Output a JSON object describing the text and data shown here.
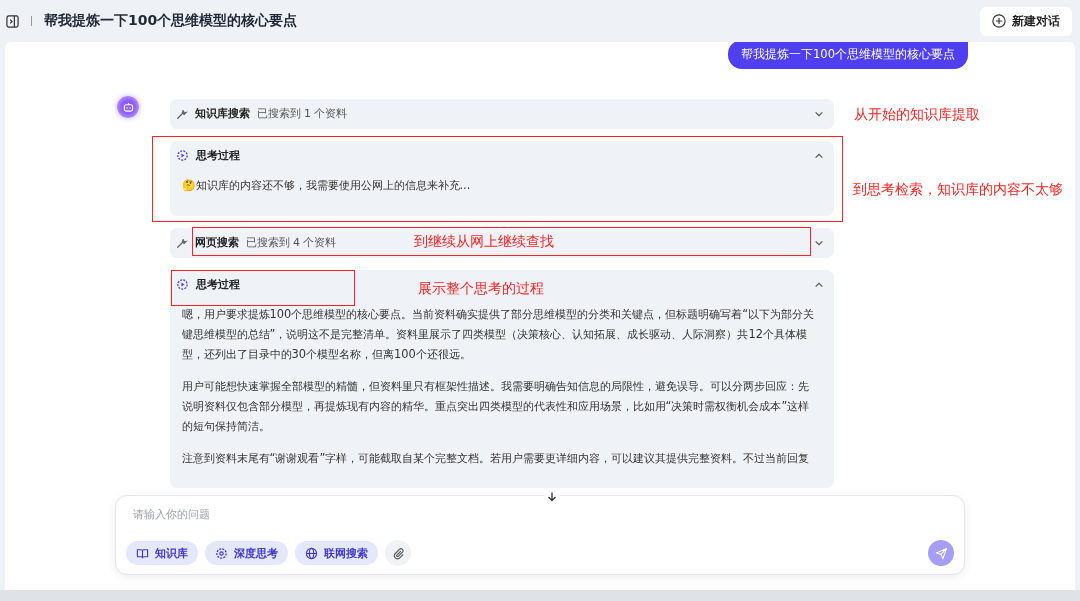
{
  "header": {
    "title": "帮我提炼一下100个思维模型的核心要点",
    "new_chat_button": "新建对话"
  },
  "user_message": "帮我提炼一下100个思维模型的核心要点",
  "blocks": [
    {
      "kind": "tool",
      "title": "知识库搜索",
      "summary": "已搜索到 1 个资料",
      "expanded": false,
      "block_outlined": false,
      "label_outlined": false,
      "header_outlined": false,
      "note": "从开始的知识库提取"
    },
    {
      "kind": "thinking",
      "title": "思考过程",
      "expanded": true,
      "block_outlined": true,
      "label_outlined": false,
      "header_outlined": false,
      "note": "到思考检索，知识库的内容不太够",
      "emoji": "🤔",
      "paragraphs": [
        "知识库的内容还不够，我需要使用公网上的信息来补充..."
      ]
    },
    {
      "kind": "tool",
      "title": "网页搜索",
      "summary": "已搜索到 4 个资料",
      "expanded": false,
      "block_outlined": false,
      "label_outlined": true,
      "header_outlined": false,
      "note": "到继续从网上继续查找"
    },
    {
      "kind": "thinking",
      "title": "思考过程",
      "expanded": true,
      "block_outlined": false,
      "label_outlined": false,
      "header_outlined": true,
      "note": "展示整个思考的过程",
      "paragraphs": [
        "嗯，用户要求提炼100个思维模型的核心要点。当前资料确实提供了部分思维模型的分类和关键点，但标题明确写着“以下为部分关键思维模型的总结”，说明这不是完整清单。资料里展示了四类模型（决策核心、认知拓展、成长驱动、人际洞察）共12个具体模型，还列出了目录中的30个模型名称，但离100个还很远。",
        "用户可能想快速掌握全部模型的精髓，但资料里只有框架性描述。我需要明确告知信息的局限性，避免误导。可以分两步回应：先说明资料仅包含部分模型，再提炼现有内容的精华。重点突出四类模型的代表性和应用场景，比如用“决策时需权衡机会成本”这样的短句保持简洁。",
        "注意到资料末尾有“谢谢观看”字样，可能截取自某个完整文档。若用户需要更详细内容，可以建议其提供完整资料。不过当前回复"
      ]
    }
  ],
  "input": {
    "placeholder": "请输入你的问题",
    "tools": [
      {
        "kind": "book",
        "label": "知识库"
      },
      {
        "kind": "gear",
        "label": "深度思考"
      },
      {
        "kind": "globe",
        "label": "联网搜索"
      }
    ]
  }
}
